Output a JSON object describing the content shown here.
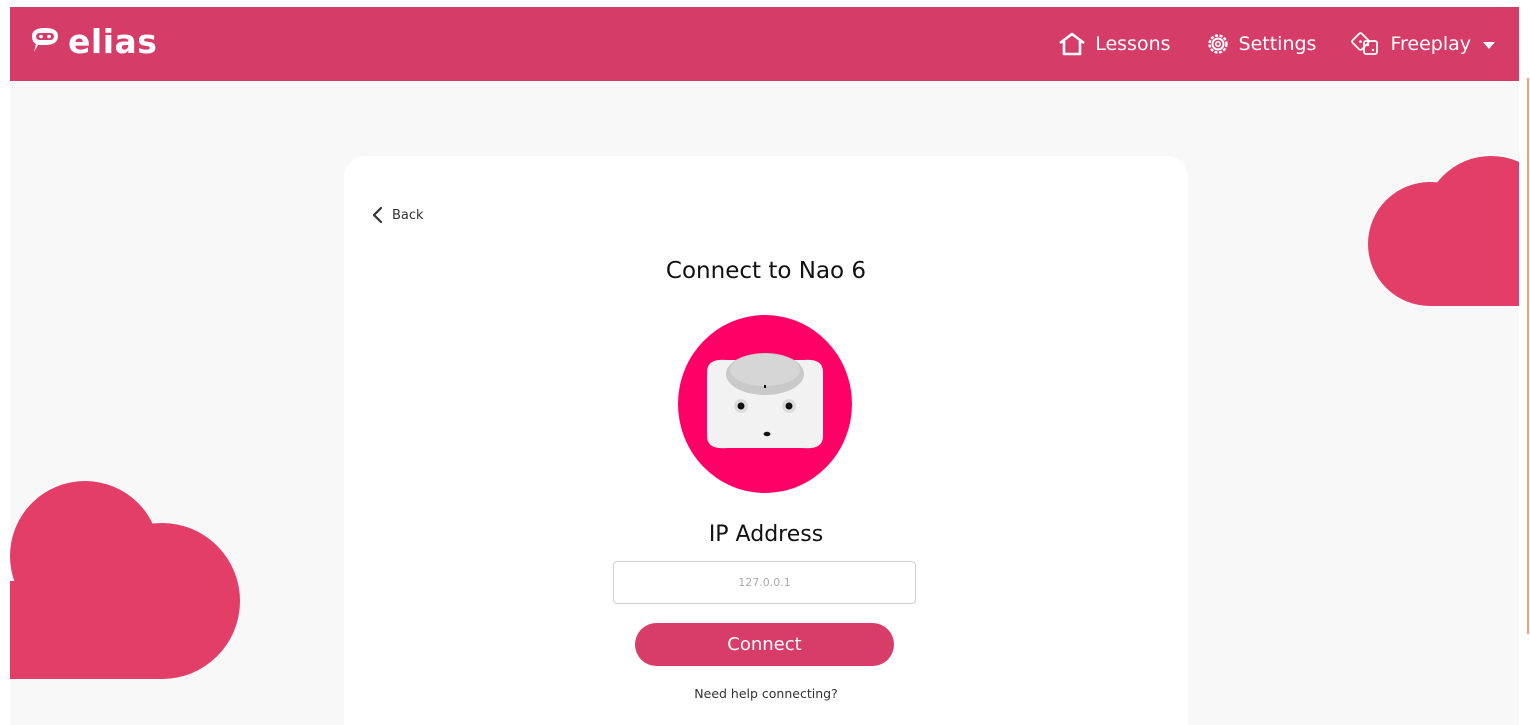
{
  "app": {
    "name": "elias"
  },
  "nav": {
    "lessons_label": "Lessons",
    "settings_label": "Settings",
    "freeplay_label": "Freeplay"
  },
  "connect": {
    "back_label": "Back",
    "title": "Connect to Nao 6",
    "ip_label": "IP Address",
    "ip_placeholder": "127.0.0.1",
    "connect_button": "Connect",
    "help_link": "Need help connecting?"
  },
  "colors": {
    "brand": "#d63c68",
    "cloud": "#e23e68",
    "robot_ring": "#ff0066",
    "background": "#f8f8f8"
  }
}
